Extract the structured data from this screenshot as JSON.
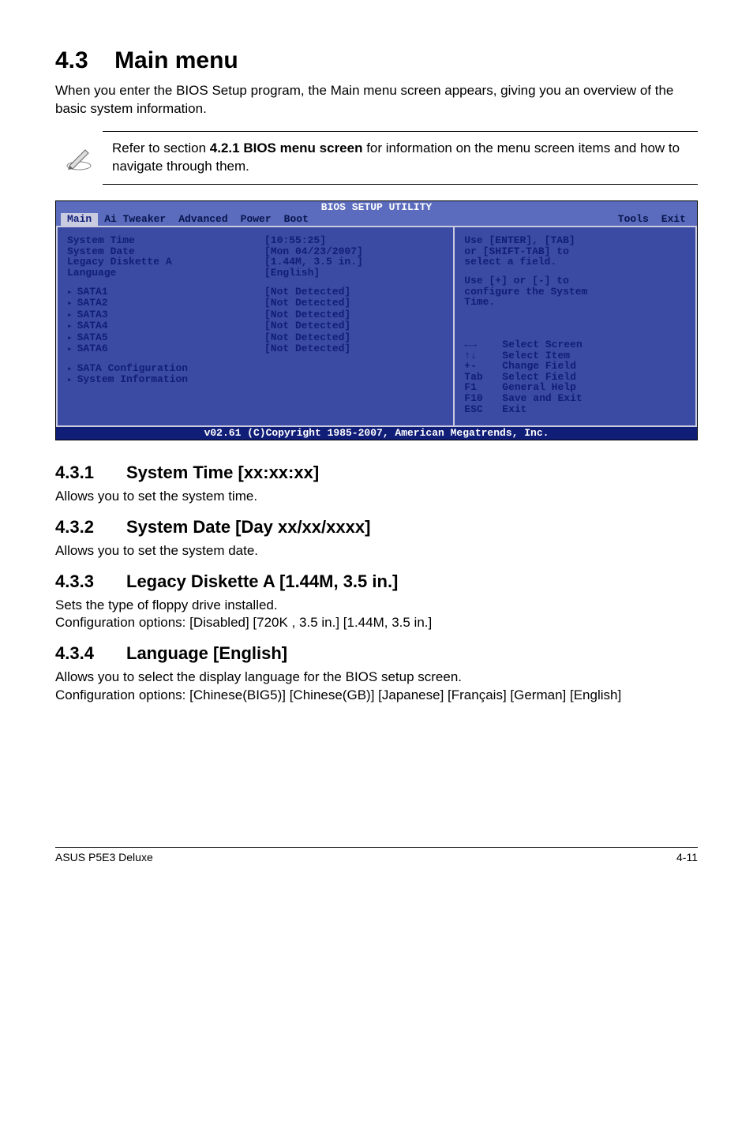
{
  "section": {
    "number": "4.3",
    "title": "Main menu"
  },
  "intro": "When you enter the BIOS Setup program, the Main menu screen appears, giving you an overview of the basic system information.",
  "note": {
    "prefix": "Refer to section ",
    "bold": "4.2.1  BIOS menu screen",
    "suffix": " for information on the menu screen items and how to navigate through them."
  },
  "bios": {
    "title": "BIOS SETUP UTILITY",
    "tabs": [
      "Main",
      "Ai Tweaker",
      "Advanced",
      "Power",
      "Boot",
      "Tools",
      "Exit"
    ],
    "active_tab": "Main",
    "left_rows": [
      {
        "label": "System Time",
        "value": "[10:55:25]"
      },
      {
        "label": "System Date",
        "value": "[Mon 04/23/2007]"
      },
      {
        "label": "Legacy Diskette A",
        "value": "[1.44M, 3.5 in.]"
      },
      {
        "label": "Language",
        "value": "[English]"
      }
    ],
    "sata_rows": [
      {
        "label": "SATA1",
        "value": "[Not Detected]"
      },
      {
        "label": "SATA2",
        "value": "[Not Detected]"
      },
      {
        "label": "SATA3",
        "value": "[Not Detected]"
      },
      {
        "label": "SATA4",
        "value": "[Not Detected]"
      },
      {
        "label": "SATA5",
        "value": "[Not Detected]"
      },
      {
        "label": "SATA6",
        "value": "[Not Detected]"
      }
    ],
    "submenus": [
      "SATA Configuration",
      "System Information"
    ],
    "help_top": [
      "Use [ENTER], [TAB]",
      "or [SHIFT-TAB] to",
      "select a field."
    ],
    "help_mid": [
      "Use [+] or [-] to",
      "configure the System",
      "Time."
    ],
    "keys": [
      {
        "k": "←→",
        "d": "Select Screen"
      },
      {
        "k": "↑↓",
        "d": "Select Item"
      },
      {
        "k": "+-",
        "d": "Change Field"
      },
      {
        "k": "Tab",
        "d": "Select Field"
      },
      {
        "k": "F1",
        "d": "General Help"
      },
      {
        "k": "F10",
        "d": "Save and Exit"
      },
      {
        "k": "ESC",
        "d": "Exit"
      }
    ],
    "footer": "v02.61 (C)Copyright 1985-2007, American Megatrends, Inc."
  },
  "subs": [
    {
      "num": "4.3.1",
      "title": "System Time [xx:xx:xx]",
      "body": [
        "Allows you to set the system time."
      ]
    },
    {
      "num": "4.3.2",
      "title": "System Date [Day xx/xx/xxxx]",
      "body": [
        "Allows you to set the system date."
      ]
    },
    {
      "num": "4.3.3",
      "title": "Legacy Diskette A [1.44M, 3.5 in.]",
      "body": [
        "Sets the type of floppy drive installed.",
        "Configuration options: [Disabled] [720K , 3.5 in.] [1.44M, 3.5 in.]"
      ]
    },
    {
      "num": "4.3.4",
      "title": "Language [English]",
      "body": [
        "Allows you to select the display language for the BIOS setup screen.",
        "Configuration options: [Chinese(BIG5)] [Chinese(GB)] [Japanese] [Français] [German] [English]"
      ]
    }
  ],
  "footer": {
    "left": "ASUS P5E3 Deluxe",
    "right": "4-11"
  }
}
